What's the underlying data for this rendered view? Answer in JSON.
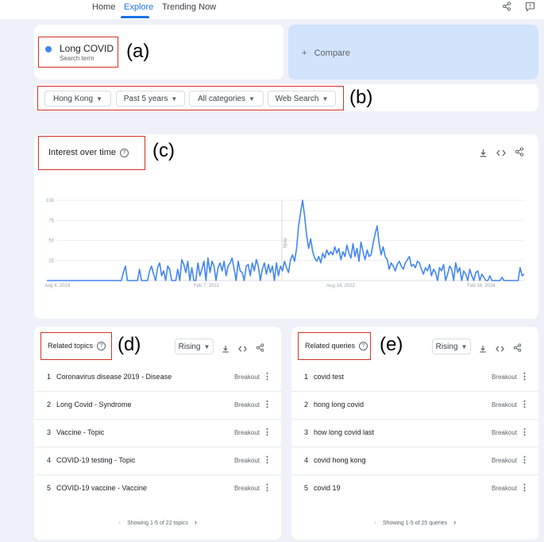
{
  "nav": {
    "home": "Home",
    "explore": "Explore",
    "trending": "Trending Now"
  },
  "term": {
    "name": "Long COVID",
    "sub": "Search term",
    "color": "#4285f4"
  },
  "compare": {
    "label": "+   Compare"
  },
  "filters": {
    "region": "Hong Kong",
    "time": "Past 5 years",
    "category": "All categories",
    "search_type": "Web Search"
  },
  "annotations": {
    "a": "(a)",
    "b": "(b)",
    "c": "(c)",
    "d": "(d)",
    "e": "(e)"
  },
  "interest": {
    "title": "Interest over time",
    "note": "Note"
  },
  "chart_data": {
    "type": "line",
    "title": "Interest over time",
    "y_ticks": [
      "100",
      "75",
      "50",
      "25"
    ],
    "x_ticks": [
      "Aug 4, 2019",
      "Feb 7, 2021",
      "Aug 14, 2022",
      "Feb 18, 2024"
    ],
    "ylim": [
      0,
      100
    ],
    "grid": true,
    "series": [
      {
        "color": "#4285f4",
        "values": [
          0,
          0,
          0,
          0,
          0,
          0,
          0,
          0,
          0,
          0,
          0,
          0,
          0,
          0,
          0,
          0,
          0,
          0,
          0,
          0,
          0,
          0,
          0,
          0,
          0,
          0,
          0,
          0,
          0,
          0,
          0,
          0,
          0,
          0,
          0,
          0,
          0,
          0,
          10,
          18,
          0,
          0,
          0,
          0,
          0,
          0,
          14,
          0,
          0,
          0,
          0,
          12,
          18,
          8,
          0,
          16,
          22,
          6,
          12,
          0,
          18,
          14,
          0,
          0,
          0,
          14,
          0,
          26,
          20,
          10,
          24,
          0,
          16,
          0,
          0,
          22,
          6,
          14,
          24,
          0,
          28,
          10,
          24,
          18,
          0,
          16,
          22,
          12,
          24,
          6,
          18,
          22,
          28,
          14,
          0,
          24,
          12,
          10,
          0,
          18,
          20,
          6,
          22,
          12,
          26,
          18,
          0,
          14,
          22,
          8,
          20,
          10,
          18,
          0,
          22,
          6,
          18,
          12,
          24,
          16,
          10,
          26,
          32,
          24,
          40,
          68,
          85,
          100,
          80,
          56,
          40,
          52,
          36,
          28,
          24,
          30,
          22,
          34,
          28,
          38,
          32,
          36,
          32,
          42,
          34,
          40,
          26,
          36,
          30,
          44,
          34,
          28,
          46,
          30,
          40,
          24,
          48,
          36,
          26,
          38,
          30,
          32,
          46,
          58,
          68,
          46,
          32,
          42,
          30,
          26,
          14,
          22,
          18,
          12,
          20,
          24,
          18,
          14,
          22,
          26,
          30,
          18,
          20,
          16,
          24,
          22,
          14,
          8,
          16,
          12,
          20,
          6,
          14,
          10,
          0,
          16,
          12,
          20,
          0,
          8,
          18,
          14,
          0,
          22,
          10,
          16,
          0,
          12,
          8,
          0,
          14,
          6,
          0,
          10,
          12,
          0,
          8,
          4,
          0,
          0,
          6,
          0,
          0,
          0,
          0,
          0,
          4,
          0,
          0,
          0,
          0,
          0,
          0,
          0,
          0,
          16,
          6,
          8
        ]
      }
    ]
  },
  "topics": {
    "title": "Related topics",
    "filter": "Rising",
    "items": [
      {
        "rank": "1",
        "label": "Coronavirus disease 2019 - Disease",
        "value": "Breakout"
      },
      {
        "rank": "2",
        "label": "Long Covid - Syndrome",
        "value": "Breakout"
      },
      {
        "rank": "3",
        "label": "Vaccine - Topic",
        "value": "Breakout"
      },
      {
        "rank": "4",
        "label": "COVID-19 testing - Topic",
        "value": "Breakout"
      },
      {
        "rank": "5",
        "label": "COVID-19 vaccine - Vaccine",
        "value": "Breakout"
      }
    ],
    "footer": "Showing 1-5 of 22 topics"
  },
  "queries": {
    "title": "Related queries",
    "filter": "Rising",
    "items": [
      {
        "rank": "1",
        "label": "covid test",
        "value": "Breakout"
      },
      {
        "rank": "2",
        "label": "hong long covid",
        "value": "Breakout"
      },
      {
        "rank": "3",
        "label": "how long covid last",
        "value": "Breakout"
      },
      {
        "rank": "4",
        "label": "covid hong kong",
        "value": "Breakout"
      },
      {
        "rank": "5",
        "label": "covid 19",
        "value": "Breakout"
      }
    ],
    "footer": "Showing 1-5 of 25 queries"
  }
}
